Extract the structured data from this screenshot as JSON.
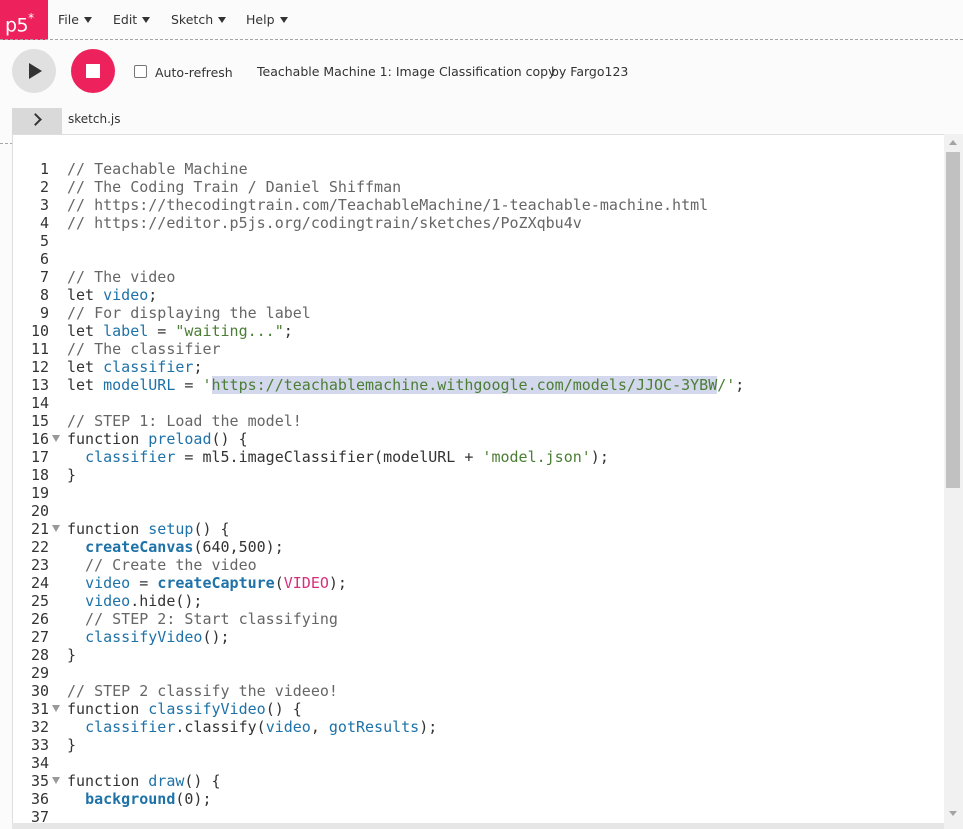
{
  "app": {
    "logo": "p5",
    "logo_mark": "*",
    "brand_color": "#ed225d"
  },
  "menu": [
    {
      "label": "File"
    },
    {
      "label": "Edit"
    },
    {
      "label": "Sketch"
    },
    {
      "label": "Help"
    }
  ],
  "toolbar": {
    "autorefresh_label": "Auto-refresh",
    "autorefresh_checked": false,
    "project_name": "Teachable Machine 1: Image Classification copy",
    "project_owner": "by Fargo123"
  },
  "tabs": {
    "active_file": "sketch.js"
  },
  "editor": {
    "lines": [
      {
        "n": "1",
        "tokens": [
          {
            "t": "// Teachable Machine",
            "c": "c"
          }
        ]
      },
      {
        "n": "2",
        "tokens": [
          {
            "t": "// The Coding Train / Daniel Shiffman",
            "c": "c"
          }
        ]
      },
      {
        "n": "3",
        "tokens": [
          {
            "t": "// https://thecodingtrain.com/TeachableMachine/1-teachable-machine.html",
            "c": "c"
          }
        ]
      },
      {
        "n": "4",
        "tokens": [
          {
            "t": "// https://editor.p5js.org/codingtrain/sketches/PoZXqbu4v",
            "c": "c"
          }
        ]
      },
      {
        "n": "5",
        "tokens": []
      },
      {
        "n": "6",
        "tokens": []
      },
      {
        "n": "7",
        "tokens": [
          {
            "t": "// The video",
            "c": "c"
          }
        ]
      },
      {
        "n": "8",
        "tokens": [
          {
            "t": "let ",
            "c": ""
          },
          {
            "t": "video",
            "c": "v"
          },
          {
            "t": ";",
            "c": ""
          }
        ]
      },
      {
        "n": "9",
        "tokens": [
          {
            "t": "// For displaying the label",
            "c": "c"
          }
        ]
      },
      {
        "n": "10",
        "tokens": [
          {
            "t": "let ",
            "c": ""
          },
          {
            "t": "label",
            "c": "v"
          },
          {
            "t": " = ",
            "c": ""
          },
          {
            "t": "\"waiting...\"",
            "c": "s"
          },
          {
            "t": ";",
            "c": ""
          }
        ]
      },
      {
        "n": "11",
        "tokens": [
          {
            "t": "// The classifier",
            "c": "c"
          }
        ]
      },
      {
        "n": "12",
        "tokens": [
          {
            "t": "let ",
            "c": ""
          },
          {
            "t": "classifier",
            "c": "v"
          },
          {
            "t": ";",
            "c": ""
          }
        ]
      },
      {
        "n": "13",
        "tokens": [
          {
            "t": "let ",
            "c": ""
          },
          {
            "t": "modelURL",
            "c": "v"
          },
          {
            "t": " = ",
            "c": ""
          },
          {
            "t": "'",
            "c": "s"
          },
          {
            "t": "https://teachablemachine.withgoogle.com/models/JJOC-3YBW",
            "c": "s hl"
          },
          {
            "t": "/'",
            "c": "s"
          },
          {
            "t": ";",
            "c": ""
          }
        ]
      },
      {
        "n": "14",
        "tokens": []
      },
      {
        "n": "15",
        "tokens": [
          {
            "t": "// STEP 1: Load the model!",
            "c": "c"
          }
        ]
      },
      {
        "n": "16",
        "fold": true,
        "tokens": [
          {
            "t": "function ",
            "c": ""
          },
          {
            "t": "preload",
            "c": "v"
          },
          {
            "t": "() {",
            "c": ""
          }
        ]
      },
      {
        "n": "17",
        "tokens": [
          {
            "t": "  ",
            "c": ""
          },
          {
            "t": "classifier",
            "c": "v"
          },
          {
            "t": " = ml5.imageClassifier(modelURL + ",
            "c": ""
          },
          {
            "t": "'model.json'",
            "c": "s"
          },
          {
            "t": ");",
            "c": ""
          }
        ]
      },
      {
        "n": "18",
        "tokens": [
          {
            "t": "}",
            "c": ""
          }
        ]
      },
      {
        "n": "19",
        "tokens": []
      },
      {
        "n": "20",
        "tokens": []
      },
      {
        "n": "21",
        "fold": true,
        "tokens": [
          {
            "t": "function ",
            "c": ""
          },
          {
            "t": "setup",
            "c": "v"
          },
          {
            "t": "() {",
            "c": ""
          }
        ]
      },
      {
        "n": "22",
        "tokens": [
          {
            "t": "  ",
            "c": ""
          },
          {
            "t": "createCanvas",
            "c": "f"
          },
          {
            "t": "(640,500);",
            "c": ""
          }
        ]
      },
      {
        "n": "23",
        "tokens": [
          {
            "t": "  // Create the video",
            "c": "c"
          }
        ]
      },
      {
        "n": "24",
        "tokens": [
          {
            "t": "  ",
            "c": ""
          },
          {
            "t": "video",
            "c": "v"
          },
          {
            "t": " = ",
            "c": ""
          },
          {
            "t": "createCapture",
            "c": "f"
          },
          {
            "t": "(",
            "c": ""
          },
          {
            "t": "VIDEO",
            "c": "k"
          },
          {
            "t": ");",
            "c": ""
          }
        ]
      },
      {
        "n": "25",
        "tokens": [
          {
            "t": "  ",
            "c": ""
          },
          {
            "t": "video",
            "c": "v"
          },
          {
            "t": ".hide();",
            "c": ""
          }
        ]
      },
      {
        "n": "26",
        "tokens": [
          {
            "t": "  // STEP 2: Start classifying",
            "c": "c"
          }
        ]
      },
      {
        "n": "27",
        "tokens": [
          {
            "t": "  ",
            "c": ""
          },
          {
            "t": "classifyVideo",
            "c": "v"
          },
          {
            "t": "();",
            "c": ""
          }
        ]
      },
      {
        "n": "28",
        "tokens": [
          {
            "t": "}",
            "c": ""
          }
        ]
      },
      {
        "n": "29",
        "tokens": []
      },
      {
        "n": "30",
        "tokens": [
          {
            "t": "// STEP 2 classify the videeo!",
            "c": "c"
          }
        ]
      },
      {
        "n": "31",
        "fold": true,
        "tokens": [
          {
            "t": "function ",
            "c": ""
          },
          {
            "t": "classifyVideo",
            "c": "v"
          },
          {
            "t": "() {",
            "c": ""
          }
        ]
      },
      {
        "n": "32",
        "tokens": [
          {
            "t": "  ",
            "c": ""
          },
          {
            "t": "classifier",
            "c": "v"
          },
          {
            "t": ".classify(",
            "c": ""
          },
          {
            "t": "video",
            "c": "v"
          },
          {
            "t": ", ",
            "c": ""
          },
          {
            "t": "gotResults",
            "c": "v"
          },
          {
            "t": ");",
            "c": ""
          }
        ]
      },
      {
        "n": "33",
        "tokens": [
          {
            "t": "}",
            "c": ""
          }
        ]
      },
      {
        "n": "34",
        "tokens": []
      },
      {
        "n": "35",
        "fold": true,
        "tokens": [
          {
            "t": "function ",
            "c": ""
          },
          {
            "t": "draw",
            "c": "v"
          },
          {
            "t": "() {",
            "c": ""
          }
        ]
      },
      {
        "n": "36",
        "tokens": [
          {
            "t": "  ",
            "c": ""
          },
          {
            "t": "background",
            "c": "f"
          },
          {
            "t": "(0);",
            "c": ""
          }
        ]
      },
      {
        "n": "37",
        "tokens": []
      }
    ]
  }
}
